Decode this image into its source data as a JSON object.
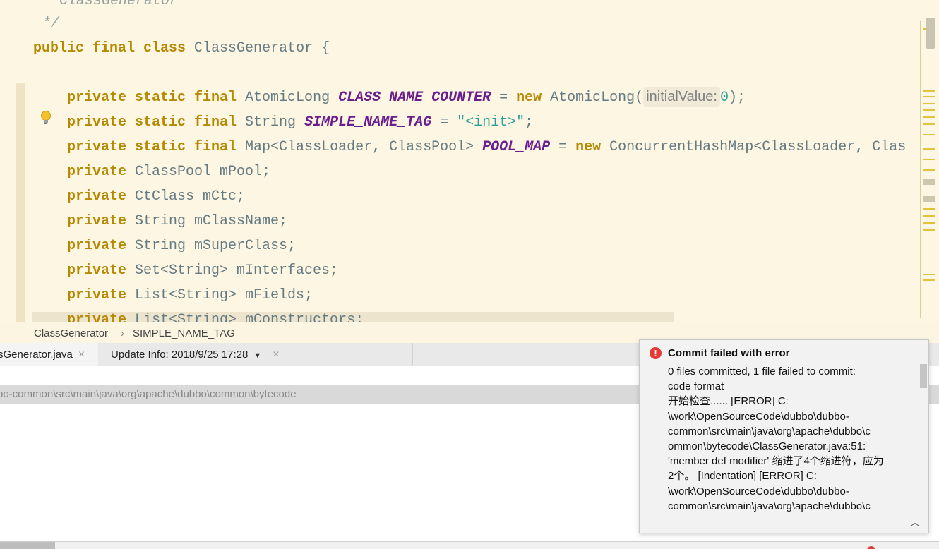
{
  "editor": {
    "lines": [
      {
        "id": "line-comment-name",
        "tokens": [
          {
            "t": " * ClassGenerator",
            "c": "cmt"
          }
        ]
      },
      {
        "id": "line-comment-end",
        "tokens": [
          {
            "t": " */",
            "c": "cmt"
          }
        ]
      },
      {
        "id": "line-class-decl",
        "tokens": [
          {
            "t": "public final class ",
            "c": "kw"
          },
          {
            "t": "ClassGenerator {",
            "c": "cname"
          }
        ]
      },
      {
        "id": "line-blank",
        "tokens": []
      },
      {
        "id": "line-counter",
        "tokens": [
          {
            "t": "private static final ",
            "c": "kw"
          },
          {
            "t": "AtomicLong ",
            "c": "cname"
          },
          {
            "t": "CLASS_NAME_COUNTER",
            "c": "const"
          },
          {
            "t": " = ",
            "c": "cname"
          },
          {
            "t": "new ",
            "c": "kw"
          },
          {
            "t": "AtomicLong(",
            "c": "cname"
          },
          {
            "t": "initialValue:",
            "c": "hint"
          },
          {
            "t": "0",
            "c": "num"
          },
          {
            "t": ");",
            "c": "cname"
          }
        ]
      },
      {
        "id": "line-name-tag",
        "tokens": [
          {
            "t": "private static final ",
            "c": "kw"
          },
          {
            "t": "String ",
            "c": "cname"
          },
          {
            "t": "SIMPLE_NAME_TAG",
            "c": "const"
          },
          {
            "t": " = ",
            "c": "cname"
          },
          {
            "t": "\"<init>\"",
            "c": "str"
          },
          {
            "t": ";",
            "c": "cname"
          }
        ]
      },
      {
        "id": "line-pool-map",
        "tokens": [
          {
            "t": "private static final ",
            "c": "kw"
          },
          {
            "t": "Map<ClassLoader, ClassPool> ",
            "c": "cname"
          },
          {
            "t": "POOL_MAP",
            "c": "const"
          },
          {
            "t": " = ",
            "c": "cname"
          },
          {
            "t": "new ",
            "c": "kw"
          },
          {
            "t": "ConcurrentHashMap<ClassLoader, Clas",
            "c": "cname"
          }
        ]
      },
      {
        "id": "line-pool",
        "tokens": [
          {
            "t": "private ",
            "c": "kw"
          },
          {
            "t": "ClassPool mPool;",
            "c": "cname"
          }
        ]
      },
      {
        "id": "line-ctc",
        "tokens": [
          {
            "t": "private ",
            "c": "kw"
          },
          {
            "t": "CtClass mCtc;",
            "c": "cname"
          }
        ]
      },
      {
        "id": "line-classname",
        "tokens": [
          {
            "t": "private ",
            "c": "kw"
          },
          {
            "t": "String mClassName;",
            "c": "cname"
          }
        ]
      },
      {
        "id": "line-superclass",
        "tokens": [
          {
            "t": "private ",
            "c": "kw"
          },
          {
            "t": "String mSuperClass;",
            "c": "cname"
          }
        ]
      },
      {
        "id": "line-interfaces",
        "tokens": [
          {
            "t": "private ",
            "c": "kw"
          },
          {
            "t": "Set<String> mInterfaces;",
            "c": "cname"
          }
        ]
      },
      {
        "id": "line-fields",
        "tokens": [
          {
            "t": "private ",
            "c": "kw"
          },
          {
            "t": "List<String> mFields;",
            "c": "cname"
          }
        ]
      },
      {
        "id": "line-constructors",
        "tokens": [
          {
            "t": "private ",
            "c": "kw"
          },
          {
            "t": "List<String> mConstructors;",
            "c": "cname"
          }
        ]
      }
    ]
  },
  "breadcrumb": {
    "class_name": "ClassGenerator",
    "separator": "›",
    "member": "SIMPLE_NAME_TAG"
  },
  "tabs": {
    "tab1_label": "sGenerator.java",
    "tab2_label": "Update Info: 2018/9/25 17:28",
    "close_glyph": "×",
    "caret_glyph": "▼"
  },
  "path_bar": {
    "text": "bo-common\\src\\main\\java\\org\\apache\\dubbo\\common\\bytecode"
  },
  "notification": {
    "icon_glyph": "!",
    "title": "Commit failed with error",
    "body_lines": [
      "0 files committed, 1 file failed to commit:",
      "code format",
      "开始检查...... [ERROR] C:",
      "\\work\\OpenSourceCode\\dubbo\\dubbo-",
      "common\\src\\main\\java\\org\\apache\\dubbo\\c",
      "ommon\\bytecode\\ClassGenerator.java:51:",
      "'member def modifier' 缩进了4个缩进符，应为",
      "2个。 [Indentation] [ERROR] C:",
      "\\work\\OpenSourceCode\\dubbo\\dubbo-",
      "common\\src\\main\\java\\org\\apache\\dubbo\\c"
    ],
    "collapse_glyph": "︿"
  },
  "colors": {
    "error_red": "#e53935",
    "editor_bg": "#fdf6e3",
    "keyword": "#b58900",
    "constant": "#6c1d8e"
  }
}
